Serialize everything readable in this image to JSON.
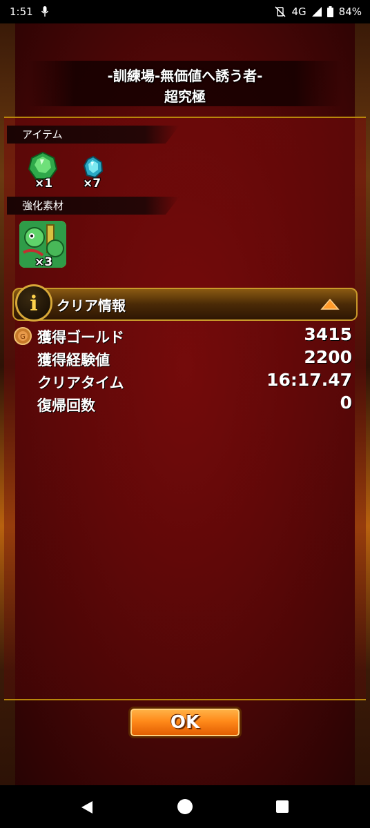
{
  "status_bar": {
    "time": "1:51",
    "network": "4G",
    "battery": "84%"
  },
  "header": {
    "title": "-訓練場-無価値へ誘う者-",
    "difficulty": "超究極"
  },
  "items_section": {
    "label": "アイテム",
    "items": [
      {
        "icon": "green-gem-icon",
        "count": "×1"
      },
      {
        "icon": "blue-gem-icon",
        "count": "×7"
      }
    ]
  },
  "materials_section": {
    "label": "強化素材",
    "items": [
      {
        "icon": "monster-card-icon",
        "count": "×3"
      }
    ]
  },
  "clear_info": {
    "title": "クリア情報",
    "badge": "i",
    "stats": [
      {
        "label": "獲得ゴールド",
        "value": "3415"
      },
      {
        "label": "獲得経験値",
        "value": "2200"
      },
      {
        "label": "クリアタイム",
        "value": "16:17.47"
      },
      {
        "label": "復帰回数",
        "value": "0"
      }
    ]
  },
  "ok_button": {
    "label": "OK"
  },
  "colors": {
    "accent_gold": "#d8a838",
    "button_orange": "#ff8a1a",
    "background_red": "#5a0808"
  }
}
